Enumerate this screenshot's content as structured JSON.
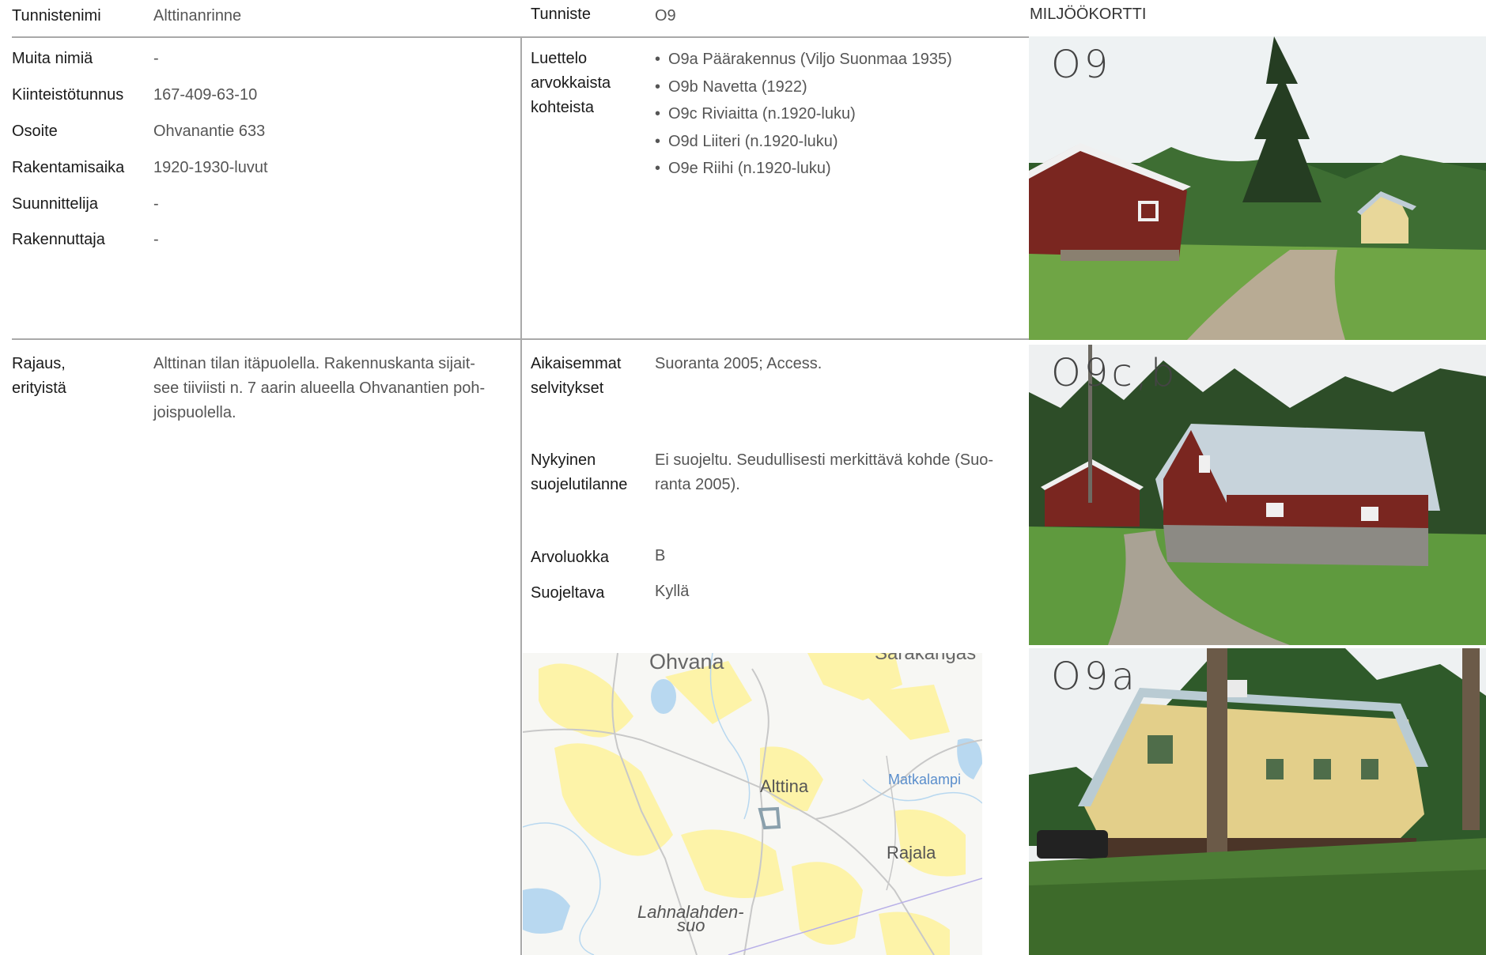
{
  "left": {
    "rows": [
      {
        "label": "Tunnistenimi",
        "value": "Alttinanrinne"
      },
      {
        "label": "Muita nimiä",
        "value": "-"
      },
      {
        "label": "Kiinteistötunnus",
        "value": "167-409-63-10"
      },
      {
        "label": "Osoite",
        "value": "Ohvanantie 633"
      },
      {
        "label": "Rakentamisaika",
        "value": "1920-1930-luvut"
      },
      {
        "label": "Suunnittelija",
        "value": "-"
      },
      {
        "label": "Rakennuttaja",
        "value": "-"
      }
    ],
    "rajaus": {
      "label_line1": "Rajaus,",
      "label_line2": "erityistä",
      "text_line1": "Alttinan tilan itäpuolella. Rakennuskanta sijait-",
      "text_line2": "see tiiviisti n. 7 aarin alueella Ohvanantien poh-",
      "text_line3": "joispuolella."
    }
  },
  "middle": {
    "tunniste": {
      "label": "Tunniste",
      "value": "O9"
    },
    "luettelo": {
      "label_line1": "Luettelo",
      "label_line2": "arvokkaista",
      "label_line3": "kohteista",
      "items": [
        "O9a Päärakennus (Viljo Suonmaa 1935)",
        "O9b Navetta (1922)",
        "O9c Riviaitta (n.1920-luku)",
        "O9d Liiteri (n.1920-luku)",
        "O9e Riihi (n.1920-luku)"
      ]
    },
    "aikaisemmat": {
      "label_line1": "Aikaisemmat",
      "label_line2": "selvitykset",
      "value": "Suoranta 2005; Access."
    },
    "nykyinen": {
      "label_line1": "Nykyinen",
      "label_line2": "suojelutilanne",
      "value_line1": "Ei suojeltu. Seudullisesti merkittävä kohde (Suo-",
      "value_line2": "ranta 2005)."
    },
    "arvoluokka": {
      "label": "Arvoluokka",
      "value": "B"
    },
    "suojeltava": {
      "label": "Suojeltava",
      "value": "Kyllä"
    },
    "bullet": "•"
  },
  "map": {
    "labels": {
      "ohvana": "Ohvana",
      "sarakangas": "Sarakangas",
      "alttina": "Alttina",
      "matkalampi": "Matkalampi",
      "rajala": "Rajala",
      "lahnalahden_1": "Lahnalahden-",
      "lahnalahden_2": "suo"
    },
    "colors": {
      "land": "#f7f7f4",
      "field": "#fdf3a8",
      "road": "#c8c8c8",
      "water": "#b8d8f0",
      "marker": "#8aa0ac"
    }
  },
  "right": {
    "header": "MILJÖÖKORTTI",
    "photos": [
      {
        "label": "O9"
      },
      {
        "label": "O9c,b"
      },
      {
        "label": "O9a"
      }
    ]
  }
}
